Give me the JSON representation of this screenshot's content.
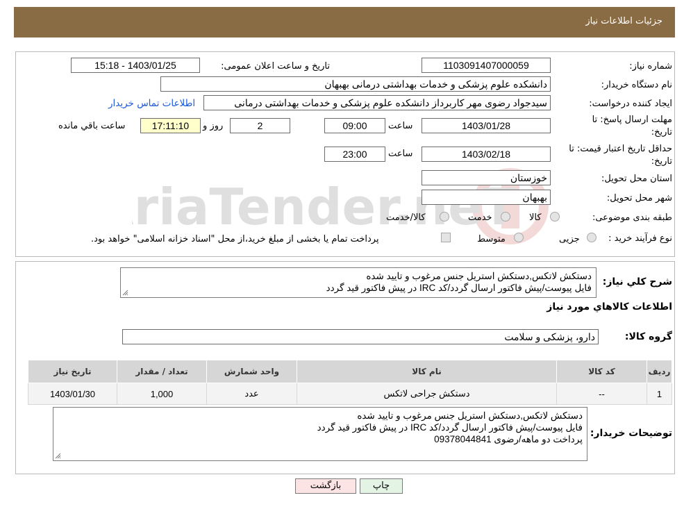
{
  "header": {
    "title": "جزئیات اطلاعات نیاز"
  },
  "fields": {
    "need_number_label": "شماره نیاز:",
    "need_number": "1103091407000059",
    "announce_label": "تاریخ و ساعت اعلان عمومی:",
    "announce_value": "1403/01/25 - 15:18",
    "buyer_org_label": "نام دستگاه خریدار:",
    "buyer_org": "دانشکده علوم پزشکی و خدمات بهداشتی  درمانی بهبهان",
    "requester_label": "ایجاد کننده درخواست:",
    "requester": "سیدجواد رضوی مهر کاربرداز دانشکده علوم پزشکی و خدمات بهداشتی  درمانی",
    "buyer_contact_link": "اطلاعات تماس خریدار",
    "deadline_label_1": "مهلت ارسال پاسخ: تا",
    "deadline_label_2": "تاریخ:",
    "deadline_date": "1403/01/28",
    "time_label": "ساعت",
    "deadline_time": "09:00",
    "days_value": "2",
    "days_label": "روز و",
    "remaining_time": "17:11:10",
    "remaining_label": "ساعت باقي مانده",
    "validity_label_1": "حداقل تاریخ اعتبار قیمت: تا",
    "validity_label_2": "تاریخ:",
    "validity_date": "1403/02/18",
    "validity_time": "23:00",
    "province_label": "استان محل تحویل:",
    "province": "خوزستان",
    "city_label": "شهر محل تحویل:",
    "city": "بهبهان",
    "category_label": "طبقه بندی موضوعی:",
    "category_options": [
      "کالا",
      "خدمت",
      "کالا/خدمت"
    ],
    "process_label": "نوع فرآیند خرید :",
    "process_options": [
      "جزیی",
      "متوسط"
    ],
    "process_note": "پرداخت تمام یا بخشی از مبلغ خرید،از محل \"اسناد خزانه اسلامی\" خواهد بود."
  },
  "watermark": {
    "text": "AriaTender.neT"
  },
  "summary": {
    "label": "شرح کلي نياز:",
    "lines": [
      "دستکش لاتکس,دستکش استریل جنس مرغوب و تایید شده",
      "فایل پیوست/پیش فاکتور ارسال گردد/کد IRC در پیش فاکتور قید گردد"
    ]
  },
  "goods": {
    "section_title": "اطلاعات کالاهاي مورد نياز",
    "group_label": "گروه کالا:",
    "group_value": "دارو، پزشکی و سلامت"
  },
  "table": {
    "headers": [
      "رديف",
      "کد کالا",
      "نام کالا",
      "واحد شمارش",
      "تعداد / مقدار",
      "تاریخ نیاز"
    ],
    "rows": [
      [
        "1",
        "--",
        "دستکش جراحی لاتکس",
        "عدد",
        "1,000",
        "1403/01/30"
      ]
    ]
  },
  "buyer_notes": {
    "label": "توضیحات خریدار:",
    "lines": [
      "دستکش لاتکس,دستکش استریل جنس مرغوب و تایید شده",
      "فایل پیوست/پیش فاکتور ارسال گردد/کد IRC در پیش فاکتور قید گردد",
      "پرداخت دو ماهه/رضوی 09378044841"
    ]
  },
  "buttons": {
    "print": "چاپ",
    "back": "بازگشت"
  },
  "colors": {
    "header_bg": "#8a6c44",
    "link": "#1a5ad8",
    "remaining_bg": "#ffffcc",
    "back_bg": "#fde4e4",
    "print_bg": "#e4f4e4"
  }
}
